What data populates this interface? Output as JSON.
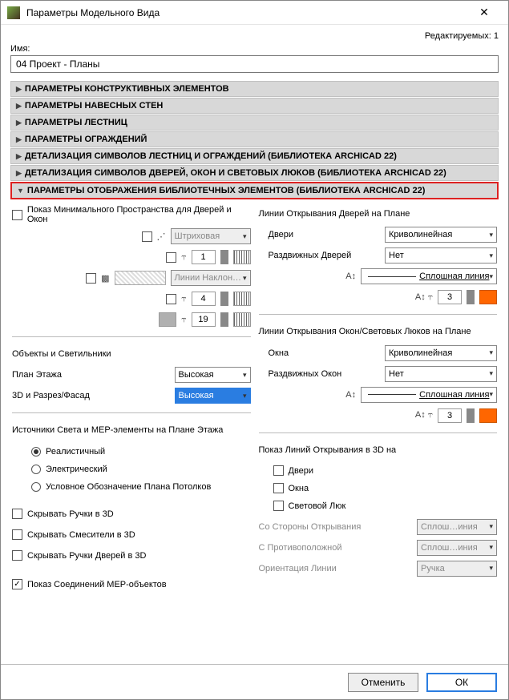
{
  "window": {
    "title": "Параметры Модельного Вида"
  },
  "header": {
    "editable_label": "Редактируемых: 1",
    "name_label": "Имя:",
    "name_value": "04 Проект - Планы"
  },
  "sections": {
    "s1": "ПАРАМЕТРЫ КОНСТРУКТИВНЫХ ЭЛЕМЕНТОВ",
    "s2": "ПАРАМЕТРЫ НАВЕСНЫХ СТЕН",
    "s3": "ПАРАМЕТРЫ ЛЕСТНИЦ",
    "s4": "ПАРАМЕТРЫ ОГРАЖДЕНИЙ",
    "s5": "ДЕТАЛИЗАЦИЯ СИМВОЛОВ ЛЕСТНИЦ И ОГРАЖДЕНИЙ (БИБЛИОТЕКА ARCHICAD 22)",
    "s6": "ДЕТАЛИЗАЦИЯ СИМВОЛОВ ДВЕРЕЙ, ОКОН И СВЕТОВЫХ ЛЮКОВ (БИБЛИОТЕКА ARCHICAD 22)",
    "s7": "ПАРАМЕТРЫ ОТОБРАЖЕНИЯ БИБЛИОТЕЧНЫХ ЭЛЕМЕНТОВ (БИБЛИОТЕКА ARCHICAD 22)"
  },
  "left": {
    "min_space_label": "Показ Минимального Пространства для Дверей и Окон",
    "hatch_label": "Штриховая",
    "pen1_value": "1",
    "fill_label": "Линии Наклон…",
    "pen2_value": "4",
    "pen3_value": "19",
    "objects_label": "Объекты и Светильники",
    "plan_label": "План Этажа",
    "plan_value": "Высокая",
    "section_label": "3D и Разрез/Фасад",
    "section_value": "Высокая",
    "lights_label": "Источники Света и МЕР-элементы на Плане Этажа",
    "radio1": "Реалистичный",
    "radio2": "Электрический",
    "radio3": "Условное Обозначение Плана Потолков",
    "cb1": "Скрывать Ручки в 3D",
    "cb2": "Скрывать Смесители в 3D",
    "cb3": "Скрывать Ручки Дверей в 3D",
    "cb4": "Показ Соединений МЕР-объектов"
  },
  "right": {
    "door_lines_label": "Линии Открывания Дверей на Плане",
    "doors_label": "Двери",
    "doors_value": "Криволинейная",
    "sliding_doors_label": "Раздвижных Дверей",
    "sliding_doors_value": "Нет",
    "line_type_value": "Сплошная линия",
    "pen_value": "3",
    "window_lines_label": "Линии Открывания Окон/Световых Люков на Плане",
    "windows_label": "Окна",
    "windows_value": "Криволинейная",
    "sliding_windows_label": "Раздвижных Окон",
    "sliding_windows_value": "Нет",
    "line_type_value2": "Сплошная линия",
    "pen_value2": "3",
    "show_3d_label": "Показ Линий Открывания в 3D на",
    "cb_doors": "Двери",
    "cb_windows": "Окна",
    "cb_skylight": "Световой Люк",
    "side_open_label": "Со Стороны Открывания",
    "side_open_value": "Сплош…иния",
    "opposite_label": "С Противоположной",
    "opposite_value": "Сплош…иния",
    "orientation_label": "Ориентация Линии",
    "orientation_value": "Ручка"
  },
  "footer": {
    "cancel": "Отменить",
    "ok": "ОК"
  }
}
